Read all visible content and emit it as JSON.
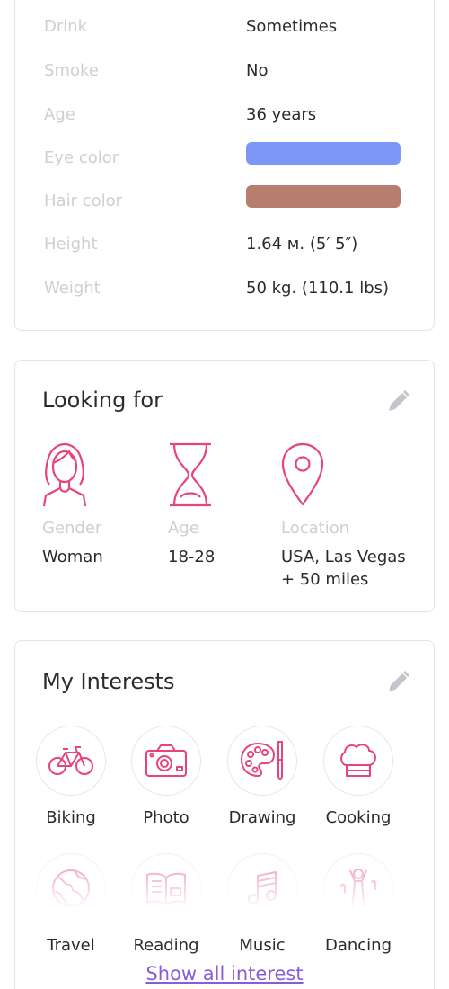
{
  "details": {
    "rows": [
      {
        "label": "Drink",
        "value": "Sometimes"
      },
      {
        "label": "Smoke",
        "value": "No"
      },
      {
        "label": "Age",
        "value": "36 years"
      },
      {
        "label": "Eye color",
        "value": ""
      },
      {
        "label": "Hair color",
        "value": ""
      },
      {
        "label": "Height",
        "value": "1.64 м. (5′ 5″)"
      },
      {
        "label": "Weight",
        "value": "50 kg. (110.1 lbs)"
      }
    ],
    "eye_color": "#7d97f7",
    "hair_color": "#b77e6d"
  },
  "looking_for": {
    "title": "Looking for",
    "edit_icon": "pencil-icon",
    "gender": {
      "caption": "Gender",
      "value": "Woman",
      "icon": "woman-icon"
    },
    "age": {
      "caption": "Age",
      "value": "18-28",
      "icon": "hourglass-icon"
    },
    "location": {
      "caption": "Location",
      "value_line1": "USA, Las Vegas",
      "value_line2": "+ 50 miles",
      "icon": "map-pin-icon"
    }
  },
  "interests": {
    "title": "My Interests",
    "edit_icon": "pencil-icon",
    "items": [
      {
        "label": "Biking",
        "icon": "bicycle-icon"
      },
      {
        "label": "Photo",
        "icon": "camera-icon"
      },
      {
        "label": "Drawing",
        "icon": "palette-icon"
      },
      {
        "label": "Cooking",
        "icon": "chef-hat-icon"
      },
      {
        "label": "Travel",
        "icon": "globe-icon"
      },
      {
        "label": "Reading",
        "icon": "book-icon"
      },
      {
        "label": "Music",
        "icon": "music-note-icon"
      },
      {
        "label": "Dancing",
        "icon": "dancer-icon"
      }
    ],
    "show_all": "Show all interest"
  },
  "colors": {
    "accent": "#e8437c",
    "link": "#8a5cd8",
    "muted_text": "#cfcfcf",
    "edit_icon": "#c4c4cc"
  }
}
